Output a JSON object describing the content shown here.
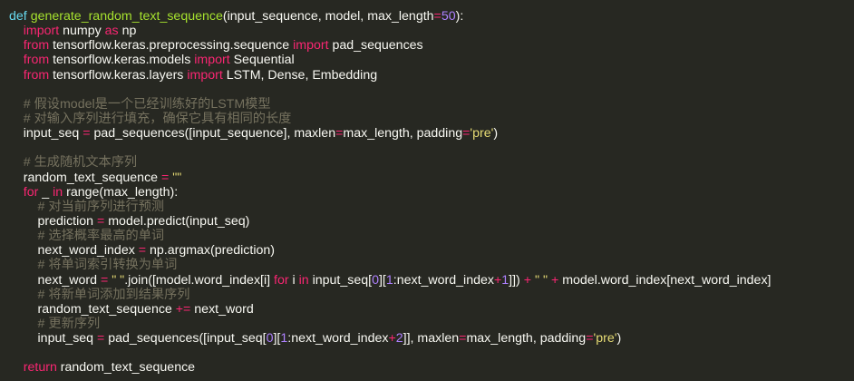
{
  "editor": {
    "colors": {
      "background": "#272822",
      "text": "#f8f8f2",
      "keyword": "#66d9ef",
      "function_name": "#a6e22e",
      "number": "#ae81ff",
      "operator": "#f92672",
      "string": "#e6db74",
      "comment": "#75715e"
    },
    "lines": [
      [
        {
          "t": "def",
          "c": "kw"
        },
        {
          "t": " "
        },
        {
          "t": "generate_random_text_sequence",
          "c": "fn"
        },
        {
          "t": "(input_sequence, model, max_length"
        },
        {
          "t": "=",
          "c": "op"
        },
        {
          "t": "50",
          "c": "num"
        },
        {
          "t": "):"
        }
      ],
      [
        {
          "t": "    "
        },
        {
          "t": "import",
          "c": "op"
        },
        {
          "t": " numpy "
        },
        {
          "t": "as",
          "c": "op"
        },
        {
          "t": " np"
        }
      ],
      [
        {
          "t": "    "
        },
        {
          "t": "from",
          "c": "op"
        },
        {
          "t": " tensorflow.keras.preprocessing.sequence "
        },
        {
          "t": "import",
          "c": "op"
        },
        {
          "t": " pad_sequences"
        }
      ],
      [
        {
          "t": "    "
        },
        {
          "t": "from",
          "c": "op"
        },
        {
          "t": " tensorflow.keras.models "
        },
        {
          "t": "import",
          "c": "op"
        },
        {
          "t": " Sequential"
        }
      ],
      [
        {
          "t": "    "
        },
        {
          "t": "from",
          "c": "op"
        },
        {
          "t": " tensorflow.keras.layers "
        },
        {
          "t": "import",
          "c": "op"
        },
        {
          "t": " LSTM, Dense, Embedding"
        }
      ],
      [],
      [
        {
          "t": "    "
        },
        {
          "t": "# 假设model是一个已经训练好的LSTM模型",
          "c": "cm"
        }
      ],
      [
        {
          "t": "    "
        },
        {
          "t": "# 对输入序列进行填充，确保它具有相同的长度",
          "c": "cm"
        }
      ],
      [
        {
          "t": "    input_seq "
        },
        {
          "t": "=",
          "c": "op"
        },
        {
          "t": " pad_sequences([input_sequence], maxlen"
        },
        {
          "t": "=",
          "c": "op"
        },
        {
          "t": "max_length, padding"
        },
        {
          "t": "=",
          "c": "op"
        },
        {
          "t": "'pre'",
          "c": "str"
        },
        {
          "t": ")"
        }
      ],
      [],
      [
        {
          "t": "    "
        },
        {
          "t": "# 生成随机文本序列",
          "c": "cm"
        }
      ],
      [
        {
          "t": "    random_text_sequence "
        },
        {
          "t": "=",
          "c": "op"
        },
        {
          "t": " "
        },
        {
          "t": "\"\"",
          "c": "str"
        }
      ],
      [
        {
          "t": "    "
        },
        {
          "t": "for",
          "c": "op"
        },
        {
          "t": " _ "
        },
        {
          "t": "in",
          "c": "op"
        },
        {
          "t": " range(max_length):"
        }
      ],
      [
        {
          "t": "        "
        },
        {
          "t": "# 对当前序列进行预测",
          "c": "cm"
        }
      ],
      [
        {
          "t": "        prediction "
        },
        {
          "t": "=",
          "c": "op"
        },
        {
          "t": " model.predict(input_seq)"
        }
      ],
      [
        {
          "t": "        "
        },
        {
          "t": "# 选择概率最高的单词",
          "c": "cm"
        }
      ],
      [
        {
          "t": "        next_word_index "
        },
        {
          "t": "=",
          "c": "op"
        },
        {
          "t": " np.argmax(prediction)"
        }
      ],
      [
        {
          "t": "        "
        },
        {
          "t": "# 将单词索引转换为单词",
          "c": "cm"
        }
      ],
      [
        {
          "t": "        next_word "
        },
        {
          "t": "=",
          "c": "op"
        },
        {
          "t": " "
        },
        {
          "t": "\" \"",
          "c": "str"
        },
        {
          "t": ".join([model.word_index[i] "
        },
        {
          "t": "for",
          "c": "op"
        },
        {
          "t": " i "
        },
        {
          "t": "in",
          "c": "op"
        },
        {
          "t": " input_seq["
        },
        {
          "t": "0",
          "c": "num"
        },
        {
          "t": "]["
        },
        {
          "t": "1",
          "c": "num"
        },
        {
          "t": ":next_word_index"
        },
        {
          "t": "+",
          "c": "op"
        },
        {
          "t": "1",
          "c": "num"
        },
        {
          "t": "]]) "
        },
        {
          "t": "+",
          "c": "op"
        },
        {
          "t": " "
        },
        {
          "t": "\" \"",
          "c": "str"
        },
        {
          "t": " "
        },
        {
          "t": "+",
          "c": "op"
        },
        {
          "t": " model.word_index[next_word_index]"
        }
      ],
      [
        {
          "t": "        "
        },
        {
          "t": "# 将新单词添加到结果序列",
          "c": "cm"
        }
      ],
      [
        {
          "t": "        random_text_sequence "
        },
        {
          "t": "+=",
          "c": "op"
        },
        {
          "t": " next_word"
        }
      ],
      [
        {
          "t": "        "
        },
        {
          "t": "# 更新序列",
          "c": "cm"
        }
      ],
      [
        {
          "t": "        input_seq "
        },
        {
          "t": "=",
          "c": "op"
        },
        {
          "t": " pad_sequences([input_seq["
        },
        {
          "t": "0",
          "c": "num"
        },
        {
          "t": "]["
        },
        {
          "t": "1",
          "c": "num"
        },
        {
          "t": ":next_word_index"
        },
        {
          "t": "+",
          "c": "op"
        },
        {
          "t": "2",
          "c": "num"
        },
        {
          "t": "]], maxlen"
        },
        {
          "t": "=",
          "c": "op"
        },
        {
          "t": "max_length, padding"
        },
        {
          "t": "=",
          "c": "op"
        },
        {
          "t": "'pre'",
          "c": "str"
        },
        {
          "t": ")"
        }
      ],
      [],
      [
        {
          "t": "    "
        },
        {
          "t": "return",
          "c": "op"
        },
        {
          "t": " random_text_sequence"
        }
      ]
    ]
  }
}
